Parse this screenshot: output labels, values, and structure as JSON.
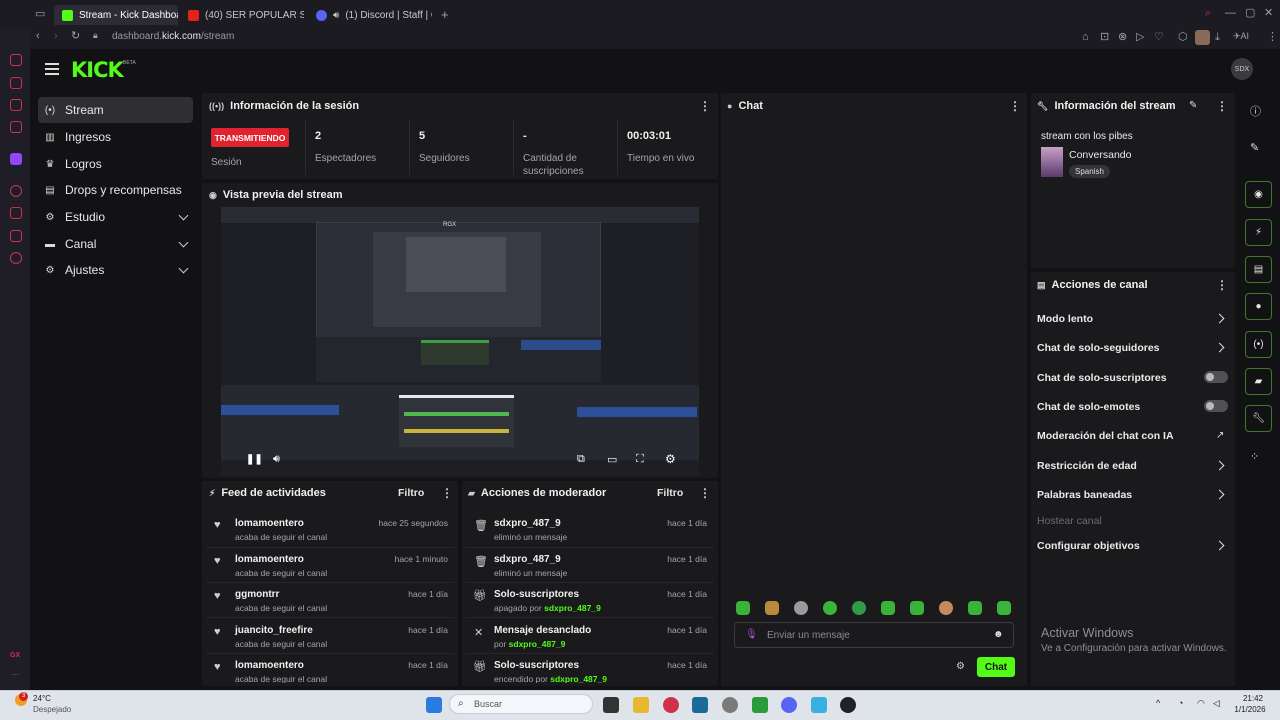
{
  "browser": {
    "tabs": [
      {
        "title": "Stream - Kick Dashboard",
        "active": true
      },
      {
        "title": "(40) SER POPULAR SIEND",
        "active": false
      },
      {
        "title": "(1) Discord | Staff | Qu",
        "active": false
      }
    ],
    "url_prefix": "dashboard.",
    "url_domain": "kick.com",
    "url_path": "/stream",
    "ai_label": "AI"
  },
  "header": {
    "logo": "KICK",
    "beta": "BETA",
    "avatar_text": "SDX"
  },
  "nav": [
    {
      "label": "Stream",
      "icon": "(•)",
      "selected": true,
      "expandable": false
    },
    {
      "label": "Ingresos",
      "icon": "▥",
      "selected": false,
      "expandable": false
    },
    {
      "label": "Logros",
      "icon": "🏆",
      "selected": false,
      "expandable": false
    },
    {
      "label": "Drops y recompensas",
      "icon": "▤",
      "selected": false,
      "expandable": false
    },
    {
      "label": "Estudio",
      "icon": "⚙",
      "selected": false,
      "expandable": true
    },
    {
      "label": "Canal",
      "icon": "▬",
      "selected": false,
      "expandable": true
    },
    {
      "label": "Ajustes",
      "icon": "⚙",
      "selected": false,
      "expandable": true
    }
  ],
  "session": {
    "title": "Información de la sesión",
    "status_badge": "TRANSMITIENDO",
    "status_label": "Sesión",
    "stats": [
      {
        "value": "2",
        "label": "Espectadores"
      },
      {
        "value": "5",
        "label": "Seguidores"
      },
      {
        "value": "-",
        "label": "Cantidad de suscripciones"
      },
      {
        "value": "00:03:01",
        "label": "Tiempo en vivo"
      }
    ]
  },
  "preview": {
    "title": "Vista previa del stream",
    "overlay_label": "RGX"
  },
  "feed": {
    "title": "Feed de actividades",
    "filter": "Filtro",
    "items": [
      {
        "name": "lomamoentero",
        "sub": "acaba de seguir el canal",
        "time": "hace 25 segundos"
      },
      {
        "name": "lomamoentero",
        "sub": "acaba de seguir el canal",
        "time": "hace 1 minuto"
      },
      {
        "name": "ggmontrr",
        "sub": "acaba de seguir el canal",
        "time": "hace 1 día"
      },
      {
        "name": "juancito_freefire",
        "sub": "acaba de seguir el canal",
        "time": "hace 1 día"
      },
      {
        "name": "lomamoentero",
        "sub": "acaba de seguir el canal",
        "time": "hace 1 día"
      }
    ]
  },
  "mod": {
    "title": "Acciones de moderador",
    "filter": "Filtro",
    "items": [
      {
        "icon": "🗑",
        "name": "sdxpro_487_9",
        "sub_pre": "eliminó un mensaje",
        "sub_user": "",
        "time": "hace 1 día"
      },
      {
        "icon": "🗑",
        "name": "sdxpro_487_9",
        "sub_pre": "eliminó un mensaje",
        "sub_user": "",
        "time": "hace 1 día"
      },
      {
        "icon": "🎁",
        "name": "Solo-suscriptores",
        "sub_pre": "apagado por ",
        "sub_user": "sdxpro_487_9",
        "time": "hace 1 día"
      },
      {
        "icon": "✕",
        "name": "Mensaje desanclado",
        "sub_pre": "por ",
        "sub_user": "sdxpro_487_9",
        "time": "hace 1 día"
      },
      {
        "icon": "🎁",
        "name": "Solo-suscriptores",
        "sub_pre": "encendido por ",
        "sub_user": "sdxpro_487_9",
        "time": "hace 1 día"
      }
    ]
  },
  "chat": {
    "title": "Chat",
    "placeholder": "Enviar un mensaje",
    "send": "Chat"
  },
  "stream_info": {
    "title": "Información del stream",
    "stream_title": "stream con los pibes",
    "category": "Conversando",
    "language": "Spanish"
  },
  "channel_actions": {
    "title": "Acciones de canal",
    "items": [
      {
        "label": "Modo lento",
        "control": "chevron"
      },
      {
        "label": "Chat de solo-seguidores",
        "control": "chevron"
      },
      {
        "label": "Chat de solo-suscriptores",
        "control": "toggle"
      },
      {
        "label": "Chat de solo-emotes",
        "control": "toggle"
      },
      {
        "label": "Moderación del chat con IA",
        "control": "external"
      },
      {
        "label": "Restricción de edad",
        "control": "chevron"
      },
      {
        "label": "Palabras baneadas",
        "control": "chevron"
      },
      {
        "label": "Hostear canal",
        "control": "disabled"
      },
      {
        "label": "Configurar objetivos",
        "control": "chevron"
      }
    ]
  },
  "windows_watermark": {
    "title": "Activar Windows",
    "subtitle": "Ve a Configuración para activar Windows."
  },
  "taskbar": {
    "weather_temp": "24°C",
    "weather_desc": "Despejado",
    "weather_badge": "3",
    "search": "Buscar",
    "time": "21:42",
    "date": "1/1/2026"
  },
  "opera_side": {
    "gx_label": "GX"
  },
  "colors": {
    "accent": "#53fc18",
    "live": "#e0232e",
    "panel": "#1a1a1d",
    "background": "#121214"
  }
}
